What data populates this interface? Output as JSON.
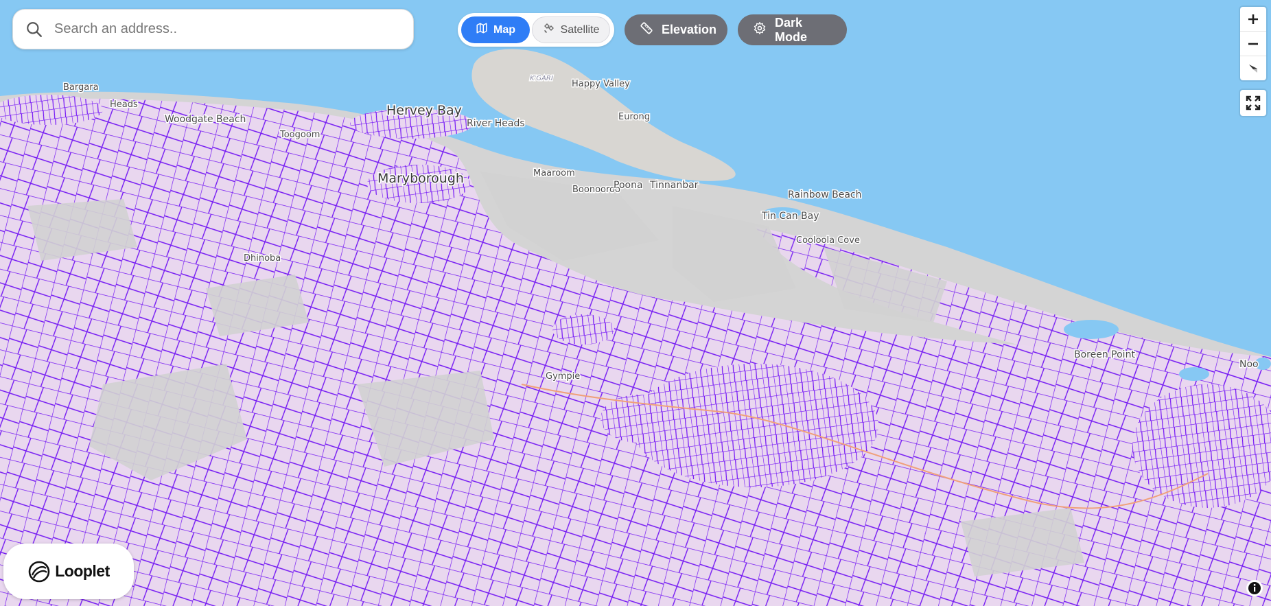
{
  "search": {
    "placeholder": "Search an address.."
  },
  "view_toggle": {
    "map_label": "Map",
    "satellite_label": "Satellite",
    "active": "Map"
  },
  "buttons": {
    "elevation_label": "Elevation",
    "dark_mode_label": "Dark Mode"
  },
  "map_controls": {
    "zoom_in": "+",
    "zoom_out": "−"
  },
  "brand": {
    "logo_text": "Looplet"
  },
  "colors": {
    "water": "#86c8f3",
    "land": "#d6d6d6",
    "parcel_fill": "#ead7f0",
    "parcel_line": "#7010f5",
    "map_active": "#2f7df6",
    "pill_bg": "#6d6e75"
  },
  "places": {
    "bargara": "Bargara",
    "heads": "Heads",
    "woodgate_beach": "Woodgate Beach",
    "hervey_bay": "Hervey Bay",
    "river_heads": "River Heads",
    "maryborough": "Maryborough",
    "kgari": "K'GARI",
    "happy_valley": "Happy Valley",
    "eurong": "Eurong",
    "poona": "Poona",
    "tinnanbar": "Tinnanbar",
    "rainbow_beach": "Rainbow Beach",
    "tin_can_bay": "Tin Can Bay",
    "cooloola_cove": "Cooloola Cove",
    "dhonoba": "Dhinoba",
    "boreen_point": "Boreen Point",
    "noosa": "Noo",
    "gympie": "Gympie",
    "toogoom": "Toogoom",
    "maaroom": "Maaroom",
    "boonooroo": "Boonooroo"
  }
}
